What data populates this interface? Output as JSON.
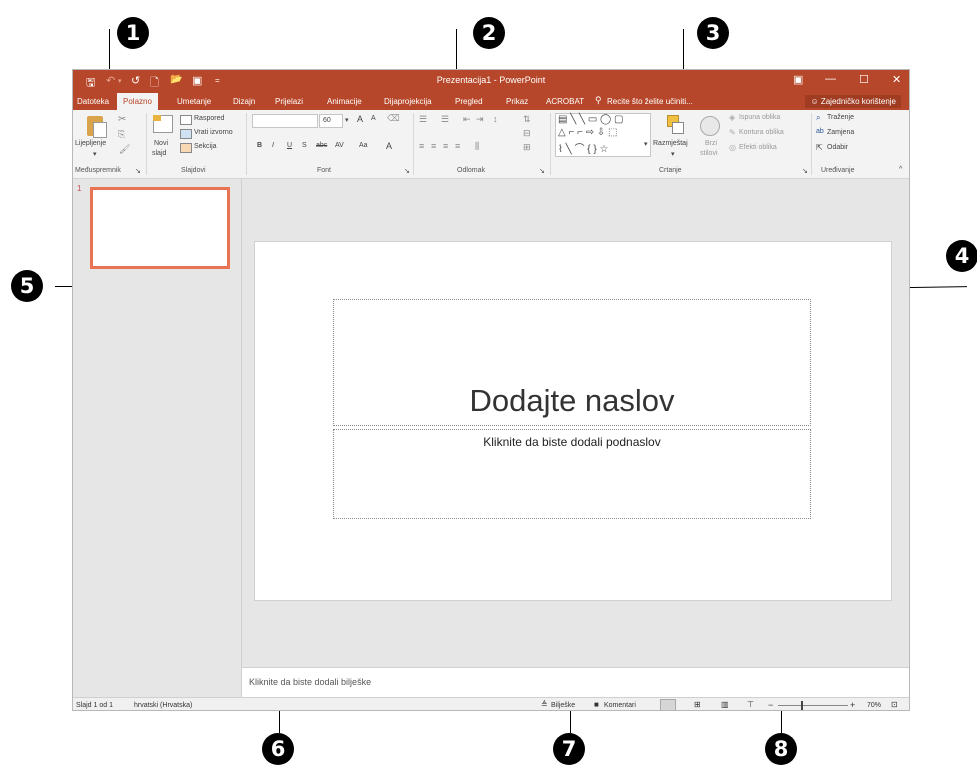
{
  "callouts": [
    "1",
    "2",
    "3",
    "4",
    "5",
    "6",
    "7",
    "8"
  ],
  "title_bar": {
    "title": "Prezentacija1 - PowerPoint",
    "qat": {
      "save": "🖫",
      "undo": "↶",
      "undo_arrow": "▾",
      "redo": "↺",
      "new": "🗋",
      "open": "📂",
      "present": "▣",
      "customize": "="
    },
    "window": {
      "restore": "▣",
      "minimize": "—",
      "maximize": "☐",
      "close": "✕"
    }
  },
  "tabs": {
    "file": "Datoteka",
    "home": "Polazno",
    "insert": "Umetanje",
    "design": "Dizajn",
    "transitions": "Prijelazi",
    "animations": "Animacije",
    "slideshow": "Dijaprojekcija",
    "review": "Pregled",
    "view": "Prikaz",
    "acrobat": "ACROBAT",
    "tell_me": "Recite što želite učiniti...",
    "share": "Zajedničko korištenje"
  },
  "ribbon": {
    "clipboard": {
      "paste": "Lijepljenje",
      "group": "Međuspremnik"
    },
    "slides": {
      "new_slide_1": "Novi",
      "new_slide_2": "slajd",
      "layout": "Raspored",
      "reset": "Vrati izvorno",
      "section": "Sekcija",
      "group": "Slajdovi"
    },
    "font": {
      "name_value": "",
      "size_value": "60",
      "bold": "B",
      "italic": "I",
      "underline": "U",
      "shadow": "S",
      "strike": "abc",
      "spacing": "AV",
      "case": "Aa",
      "color": "A",
      "grow": "A",
      "shrink": "A",
      "group": "Font"
    },
    "paragraph": {
      "group": "Odlomak"
    },
    "drawing": {
      "arrange": "Razmještaj",
      "quick_styles_1": "Brzi",
      "quick_styles_2": "stilovi",
      "fill": "Ispuna oblika",
      "outline": "Kontura oblika",
      "effects": "Efekti oblika",
      "group": "Crtanje"
    },
    "editing": {
      "find": "Traženje",
      "replace": "Zamjena",
      "select": "Odabir",
      "group": "Uređivanje"
    },
    "collapse": "^"
  },
  "thumbnail": {
    "number": "1"
  },
  "slide": {
    "title_placeholder": "Dodajte naslov",
    "subtitle_placeholder": "Kliknite da biste dodali podnaslov"
  },
  "notes": {
    "placeholder": "Kliknite da biste dodali bilješke"
  },
  "status_bar": {
    "slide_info": "Slajd 1 od 1",
    "language": "hrvatski (Hrvatska)",
    "notes": "Bilješke",
    "comments": "Komentari",
    "zoom_minus": "−",
    "zoom_plus": "+",
    "zoom": "70%"
  },
  "colors": {
    "accent": "#b7472a",
    "thumbnail_border": "#e97454"
  }
}
